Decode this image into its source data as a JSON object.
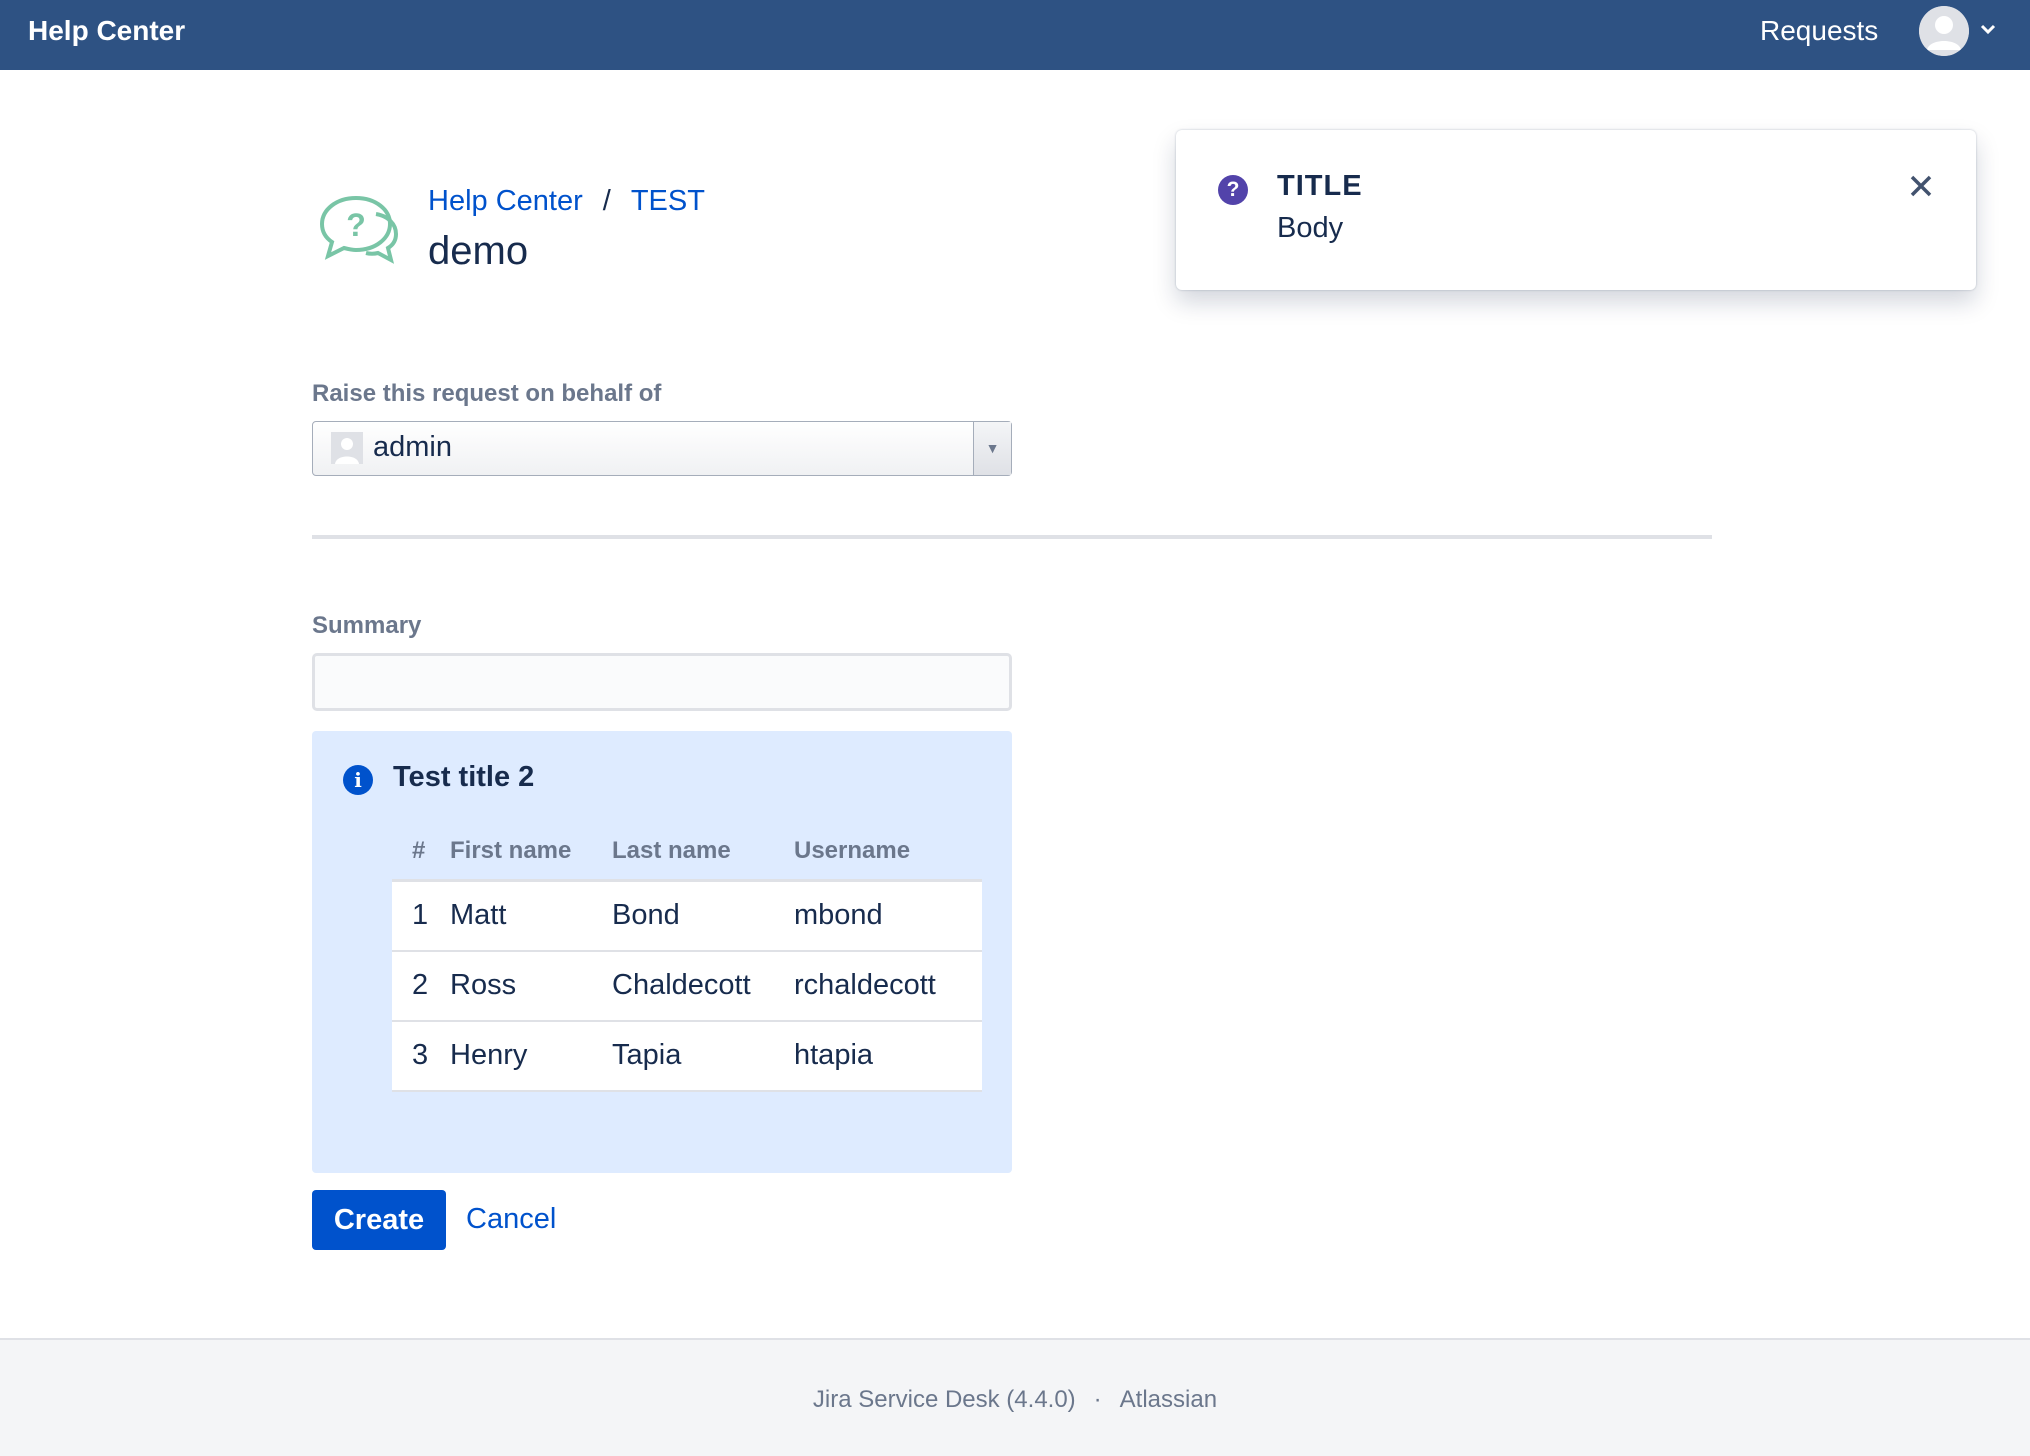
{
  "topbar": {
    "brand": "Help Center",
    "requests_label": "Requests"
  },
  "breadcrumb": {
    "root": "Help Center",
    "separator": "/",
    "project": "TEST"
  },
  "page_title": "demo",
  "flag": {
    "title": "TITLE",
    "body": "Body",
    "icon": "question-circle-icon"
  },
  "form": {
    "on_behalf_label": "Raise this request on behalf of",
    "on_behalf_value": "admin",
    "summary_label": "Summary",
    "summary_value": ""
  },
  "info_panel": {
    "title": "Test title 2",
    "columns": [
      "#",
      "First name",
      "Last name",
      "Username"
    ],
    "rows": [
      [
        "1",
        "Matt",
        "Bond",
        "mbond"
      ],
      [
        "2",
        "Ross",
        "Chaldecott",
        "rchaldecott"
      ],
      [
        "3",
        "Henry",
        "Tapia",
        "htapia"
      ]
    ]
  },
  "actions": {
    "create_label": "Create",
    "cancel_label": "Cancel"
  },
  "footer": {
    "product": "Jira Service Desk (4.4.0)",
    "separator": "·",
    "company": "Atlassian"
  },
  "colors": {
    "topbar": "#2e5283",
    "link": "#0052cc",
    "info_bg": "#deebff",
    "flag_icon": "#5243aa"
  }
}
